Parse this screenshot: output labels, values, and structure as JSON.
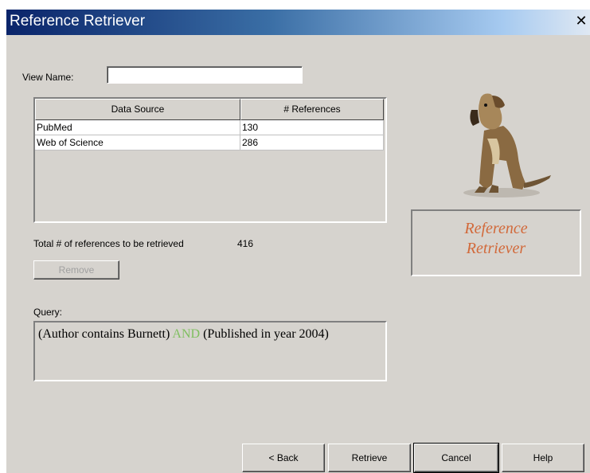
{
  "window": {
    "title": "Reference Retriever",
    "close_glyph": "X"
  },
  "view_name": {
    "label": "View Name:",
    "value": ""
  },
  "table": {
    "columns": [
      "Data Source",
      "# References"
    ],
    "rows": [
      [
        "PubMed",
        "130"
      ],
      [
        "Web of Science",
        "286"
      ]
    ]
  },
  "total": {
    "label": "Total # of references to be retrieved",
    "value": "416"
  },
  "remove_button": "Remove",
  "query": {
    "label": "Query:",
    "part1": "(Author contains Burnett) ",
    "operator": "AND",
    "part2": " (Published in year 2004)",
    "operator_color": "#7fbf5f"
  },
  "logo": {
    "line1": "Reference",
    "line2": "Retriever",
    "color": "#d2693a",
    "image": "dog-icon"
  },
  "footer": {
    "back": "< Back",
    "retrieve": "Retrieve",
    "cancel": "Cancel",
    "help": "Help"
  }
}
